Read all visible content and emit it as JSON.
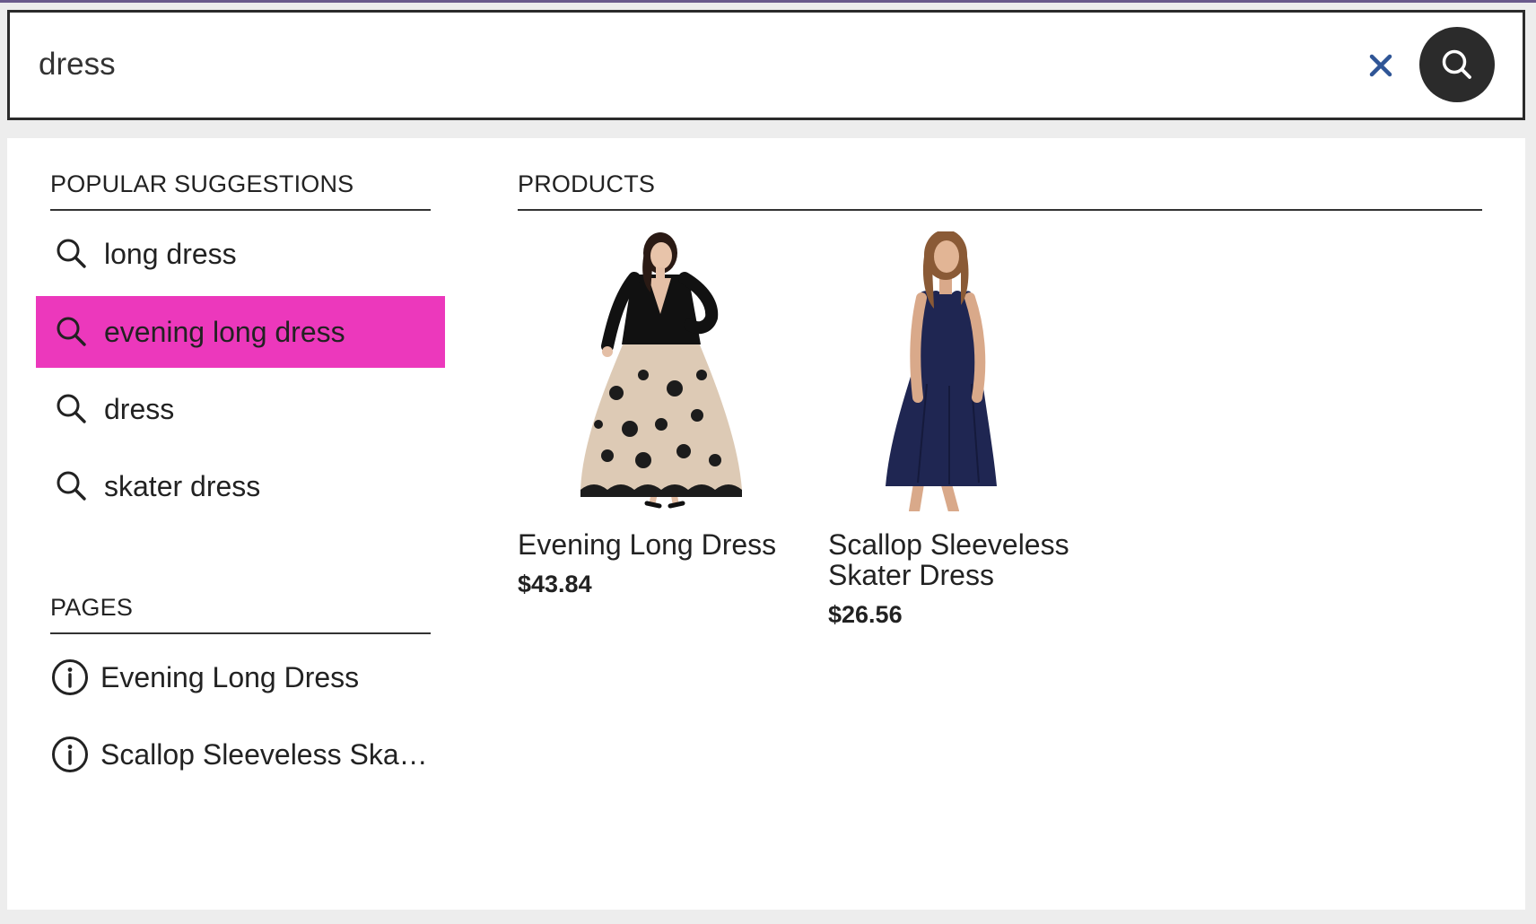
{
  "search": {
    "value": "dress",
    "placeholder": ""
  },
  "suggestions": {
    "title": "POPULAR SUGGESTIONS",
    "items": [
      {
        "label": "long dress"
      },
      {
        "label": "evening long dress",
        "active": true
      },
      {
        "label": "dress"
      },
      {
        "label": "skater dress"
      }
    ]
  },
  "pages": {
    "title": "PAGES",
    "items": [
      {
        "label": "Evening Long Dress"
      },
      {
        "label": "Scallop Sleeveless Ska…"
      }
    ]
  },
  "products": {
    "title": "PRODUCTS",
    "items": [
      {
        "name": "Evening Long Dress",
        "price": "$43.84"
      },
      {
        "name": "Scallop Sleeveless Skater Dress",
        "price": "$26.56"
      }
    ]
  },
  "colors": {
    "highlight": "#ec38bc",
    "search_button": "#2b2b2b",
    "clear_icon": "#2f5596"
  }
}
